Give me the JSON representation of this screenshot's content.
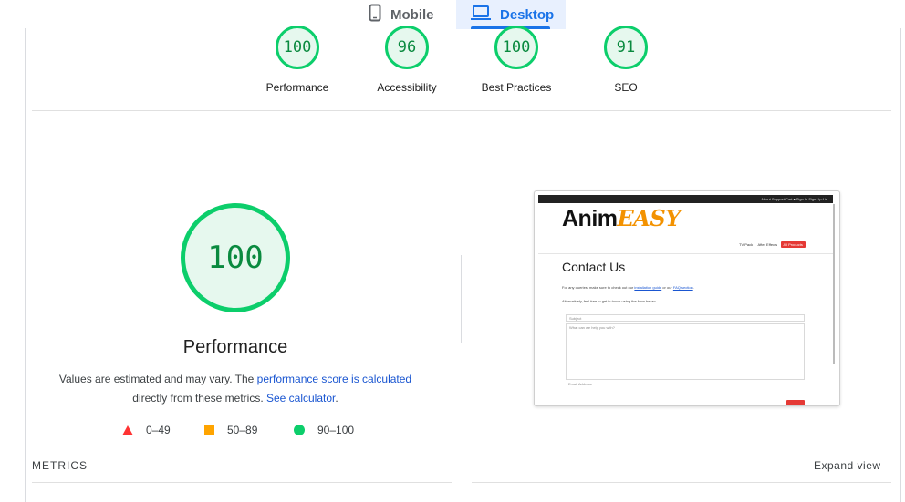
{
  "tabs": {
    "mobile": "Mobile",
    "desktop": "Desktop"
  },
  "categories": [
    {
      "score": "100",
      "label": "Performance"
    },
    {
      "score": "96",
      "label": "Accessibility"
    },
    {
      "score": "100",
      "label": "Best Practices"
    },
    {
      "score": "91",
      "label": "SEO"
    }
  ],
  "performance": {
    "score": "100",
    "title": "Performance",
    "desc_prefix": "Values are estimated and may vary. The ",
    "desc_link1": "performance score is calculated",
    "desc_middle": " directly from these metrics. ",
    "desc_link2": "See calculator",
    "desc_suffix": "."
  },
  "legend": {
    "fail": "0–49",
    "average": "50–89",
    "pass": "90–100"
  },
  "metrics": {
    "label": "METRICS",
    "expand": "Expand view"
  },
  "screenshot": {
    "topnav": "About   Support   Cart ▾   Sign In   Sign Up   f   in",
    "logo_main": "Anim",
    "logo_accent": "EASY",
    "catnav_1": "TV Pack",
    "catnav_2": "After Effects",
    "catnav_3": "All Products",
    "heading": "Contact Us",
    "line1_prefix": "For any queries, make sure to check out our ",
    "line1_link1": "installation guide",
    "line1_middle": " or our ",
    "line1_link2": "FAQ section",
    "line1_suffix": ".",
    "line2": "Alternatively, feel free to get in touch using the form below.",
    "subject_placeholder": "Subject",
    "message_placeholder": "What can we help you with?",
    "email_placeholder": "Email Address"
  },
  "colors": {
    "pass": "#0cce6b",
    "average": "#ffa400",
    "fail": "#ff3333",
    "link": "#1a56d1",
    "accent": "#1a73e8"
  }
}
